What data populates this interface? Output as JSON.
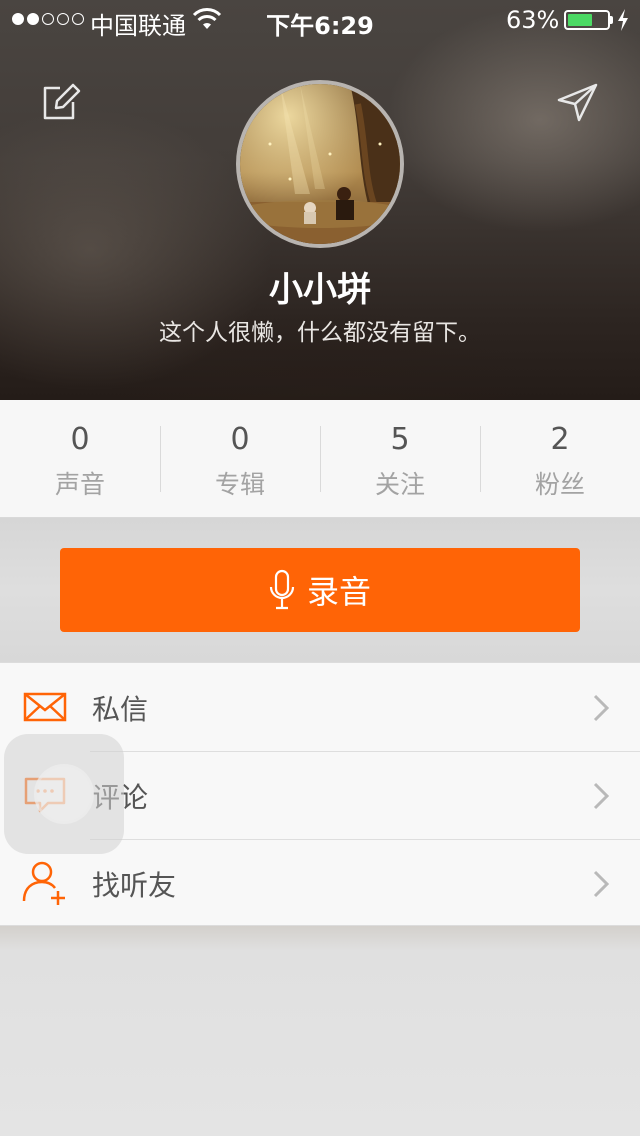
{
  "status_bar": {
    "carrier": "中国联通",
    "time": "下午6:29",
    "battery_percent": "63%",
    "battery_level": 0.63,
    "signal_bars": 2
  },
  "header": {
    "edit_icon": "edit-icon",
    "send_icon": "send-icon",
    "username": "小小垪",
    "bio": "这个人很懒，什么都没有留下。"
  },
  "stats": [
    {
      "value": "0",
      "label": "声音"
    },
    {
      "value": "0",
      "label": "专辑"
    },
    {
      "value": "5",
      "label": "关注"
    },
    {
      "value": "2",
      "label": "粉丝"
    }
  ],
  "record": {
    "label": "录音",
    "icon": "microphone-icon"
  },
  "menu": [
    {
      "label": "私信",
      "icon": "envelope-icon"
    },
    {
      "label": "评论",
      "icon": "comment-icon"
    },
    {
      "label": "找听友",
      "icon": "add-friend-icon"
    }
  ],
  "colors": {
    "accent": "#ff6406",
    "battery": "#4cd964"
  }
}
